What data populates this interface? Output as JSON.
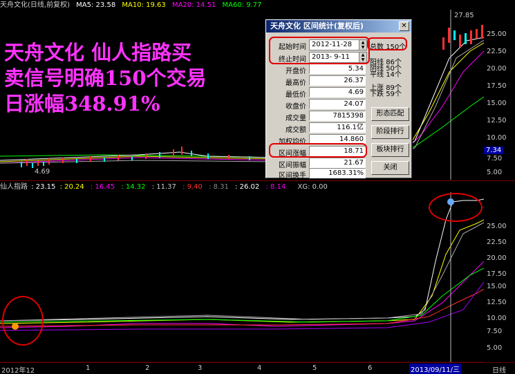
{
  "top_header": {
    "title": "天舟文化(日线,前复权)",
    "ma5": "MA5: 23.58",
    "ma10": "MA10: 19.63",
    "ma20": "MA20: 14.51",
    "ma60": "MA60: 9.77"
  },
  "top_scale": [
    "25.00",
    "22.50",
    "20.00",
    "17.50",
    "15.00",
    "12.50",
    "10.00",
    "7.50",
    "5.00"
  ],
  "top_annotations": {
    "high": "27.85",
    "low": "4.69",
    "current": "7.34"
  },
  "promo_lines": [
    "天舟文化 仙人指路买",
    "卖信号明确150个交易",
    "日涨幅348.91%"
  ],
  "indicator_header": {
    "name": "仙人指路",
    "v1": ": 23.15",
    "v2": ": 20.24",
    "v3": ": 16.45",
    "v4": ": 14.32",
    "v5": ": 11.37",
    "v6": ": 9.40",
    "v7": ": 8.31",
    "v8": ": 26.02",
    "v9": ": 8.14",
    "xg": "XG: 0.00"
  },
  "bottom_scale": [
    "25.00",
    "22.50",
    "20.00",
    "17.50",
    "15.00",
    "12.50",
    "10.00",
    "7.50",
    "5.00"
  ],
  "x_axis": {
    "start": "2012年12",
    "ticks": [
      "1",
      "2",
      "3",
      "4",
      "5",
      "6"
    ],
    "cursor_date": "2013/09/11/三",
    "period": "日线"
  },
  "dialog": {
    "title": "天舟文化 区间统计(复权后)",
    "close": "✕",
    "start_label": "起始时间",
    "start_value": "2012-11-28",
    "end_label": "终止时间",
    "end_value": "2013- 9-11",
    "total_label": "总数",
    "total_value": "150个",
    "yang_label": "阳线",
    "yang_value": "86个",
    "yin_label": "阴线",
    "yin_value": "50个",
    "ping_label": "平线",
    "ping_value": "14个",
    "up_label": "上涨",
    "up_value": "89个",
    "down_label": "下跌",
    "down_value": "59个",
    "rows": [
      {
        "label": "开盘价",
        "value": "5.34"
      },
      {
        "label": "最高价",
        "value": "26.37"
      },
      {
        "label": "最低价",
        "value": "4.69"
      },
      {
        "label": "收盘价",
        "value": "24.07"
      },
      {
        "label": "成交量",
        "value": "7815398"
      },
      {
        "label": "成交额",
        "value": "116.1亿"
      },
      {
        "label": "加权均价",
        "value": "14.860"
      },
      {
        "label": "区间涨幅",
        "value": "18.71 (348.91%)"
      },
      {
        "label": "区间振幅",
        "value": "21.67 (461.66%)"
      },
      {
        "label": "区间换手",
        "value": "1683.31%"
      }
    ],
    "buttons": [
      "形态匹配",
      "阶段排行",
      "板块排行",
      "关闭"
    ]
  },
  "colors": {
    "ma5": "#ffffff",
    "ma10": "#ffff00",
    "ma20": "#ff00ff",
    "ma60": "#00ff00",
    "promo": "#ff33ff",
    "annotation": "#e00000",
    "cursor_bg": "#0000a0"
  }
}
